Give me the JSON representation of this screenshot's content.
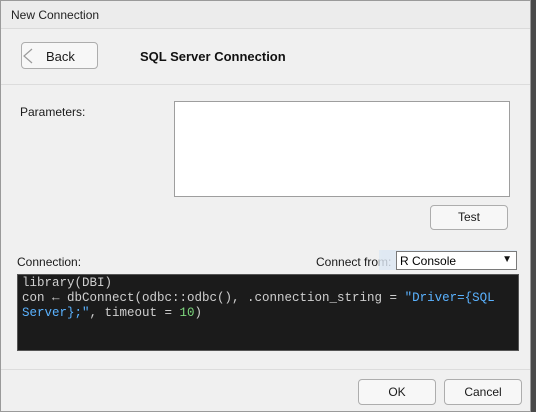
{
  "window": {
    "title": "New Connection"
  },
  "header": {
    "back_label": "Back",
    "title": "SQL Server Connection"
  },
  "parameters": {
    "label": "Parameters:",
    "value": ""
  },
  "test_button": {
    "label": "Test"
  },
  "connection": {
    "label": "Connection:",
    "connect_from_label": "Connect from:",
    "connect_from_value": "R Console",
    "ghost_text": "ectangu"
  },
  "code": {
    "line1": "library(DBI)",
    "line2_prefix": "con ← dbConnect(odbc::odbc(), .connection_string = ",
    "line2_string": "\"Driver={SQL",
    "line3_string": "Server};\"",
    "line3_mid": ", timeout = ",
    "line3_number": "10",
    "line3_end": ")"
  },
  "footer": {
    "ok_label": "OK",
    "cancel_label": "Cancel"
  },
  "colors": {
    "code_background": "#1b1b1b",
    "code_string": "#5ab2ff",
    "code_number": "#7ed87e"
  }
}
